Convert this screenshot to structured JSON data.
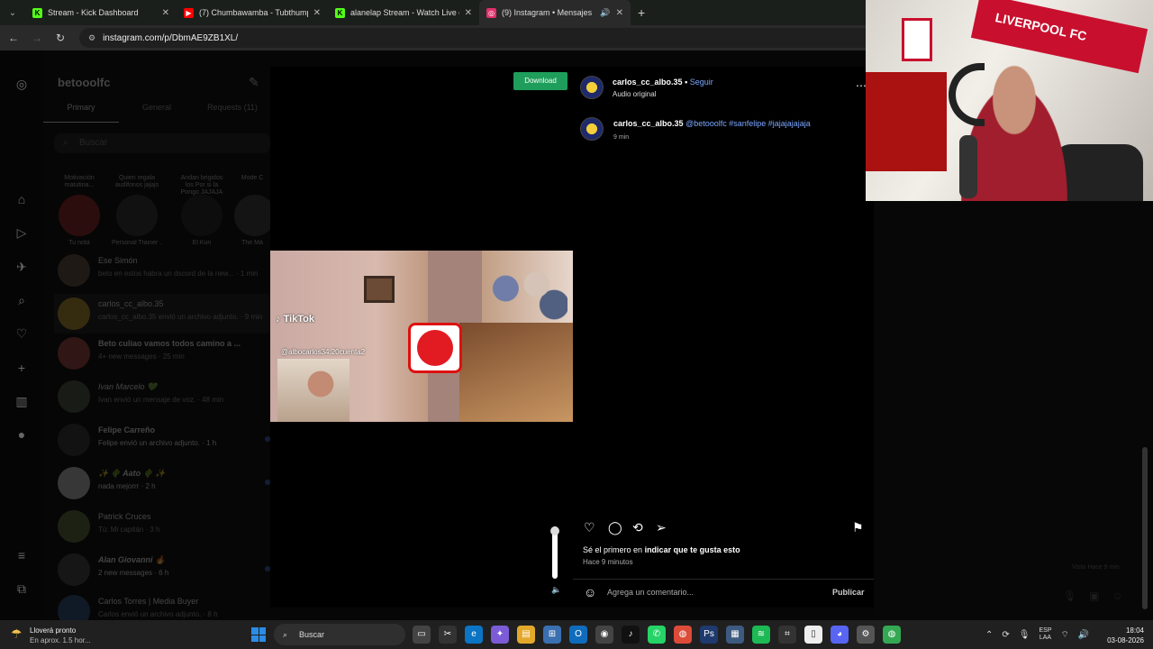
{
  "browser": {
    "tabs": [
      {
        "title": "Stream - Kick Dashboard",
        "icon": "kick-icon",
        "color": "#53fc18"
      },
      {
        "title": "(7) Chumbawamba - Tubthump",
        "icon": "youtube-icon",
        "color": "#ff0000"
      },
      {
        "title": "alanelap Stream - Watch Live o",
        "icon": "kick-icon",
        "color": "#53fc18"
      },
      {
        "title": "(9) Instagram • Mensajes",
        "icon": "instagram-icon",
        "color": "#e1306c"
      }
    ],
    "url": "instagram.com/p/DbmAE9ZB1XL/"
  },
  "dm": {
    "username": "betooolfc",
    "tabs": [
      "Primary",
      "General",
      "Requests (11)"
    ],
    "search_placeholder": "Buscar",
    "notes": [
      {
        "bubble": "Motivación matutina...",
        "name": "Tu nota"
      },
      {
        "bubble": "Quien regala audifonos jajajs",
        "name": "Personal Trainer ..."
      },
      {
        "bubble": "Andan brigidos los Por si la Pongo JAJAJA",
        "name": "El Kun"
      },
      {
        "bubble": "Mode C",
        "name": "The Má"
      }
    ],
    "conversations": [
      {
        "name": "Ese Simón",
        "msg": "beto en estos habra un dscord de la new... · 1 min"
      },
      {
        "name": "carlos_cc_albo.35",
        "msg": "carlos_cc_albo.35 envió un archivo adjunto. · 9 min"
      },
      {
        "name": "Beto culiao vamos todos camino a ...",
        "msg": "4+ new messages · 25 min"
      },
      {
        "name": "Ivan Marcelo 💚",
        "msg": "Ivan envió un mensaje de voz. · 48 min"
      },
      {
        "name": "Felipe Carreño",
        "msg": "Felipe envió un archivo adjunto. · 1 h"
      },
      {
        "name": "✨ 🌵 Aato 🌵 ✨",
        "msg": "nada mejorrr · 2 h"
      },
      {
        "name": "Patrick Cruces",
        "msg": "Tú: Mi capitán · 3 h"
      },
      {
        "name": "Alan Giovanni 🔥",
        "msg": "2 new messages · 6 h"
      },
      {
        "name": "Carlos Torres | Media Buyer",
        "msg": "Carlos envió un archivo adjunto. · 8 h"
      }
    ]
  },
  "video": {
    "download_label": "Download",
    "tiktok_label": "TikTok",
    "tiktok_user": "@albocarlos34.20cuenta2"
  },
  "post": {
    "author": "carlos_cc_albo.35",
    "follow_label": "Seguir",
    "audio": "Audio original",
    "caption_user": "carlos_cc_albo.35",
    "caption_text": "@betooolfc #sanfelipe #jajajajajaja",
    "caption_time": "9 min",
    "likes_prefix": "Sé el primero en",
    "likes_bold": "indicar que te gusta esto",
    "posted_ago": "Hace 9 minutos",
    "comment_placeholder": "Agrega un comentario...",
    "publish_label": "Publicar"
  },
  "right": {
    "seen": "Visto Hace 9 min"
  },
  "taskbar": {
    "weather_line1": "Lloverá pronto",
    "weather_line2": "En aprox. 1.5 hor...",
    "search": "Buscar",
    "lang1": "ESP",
    "lang2": "LAA",
    "time": "18:04",
    "date": "03-08-2026"
  }
}
